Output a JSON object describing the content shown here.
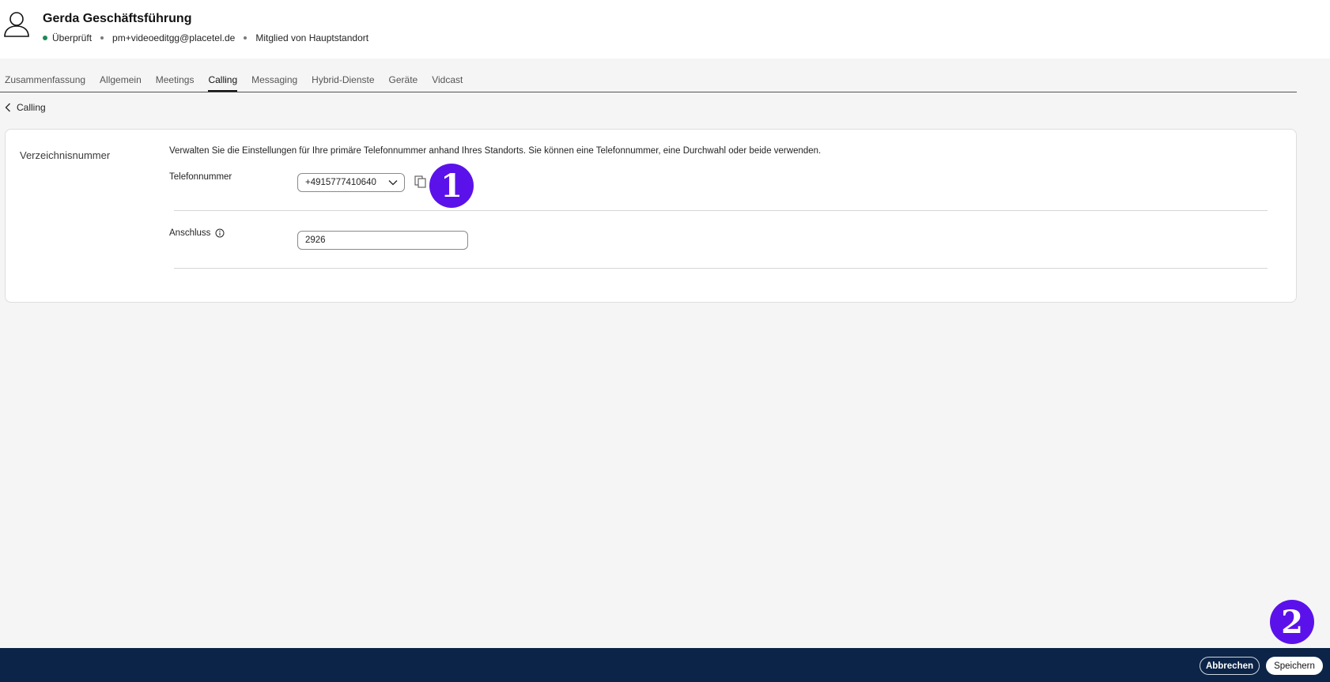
{
  "user": {
    "name": "Gerda Geschäftsführung",
    "status": "Überprüft",
    "email": "pm+videoeditgg@placetel.de",
    "membership": "Mitglied von Hauptstandort"
  },
  "tabs": [
    {
      "label": "Zusammenfassung",
      "active": false
    },
    {
      "label": "Allgemein",
      "active": false
    },
    {
      "label": "Meetings",
      "active": false
    },
    {
      "label": "Calling",
      "active": true
    },
    {
      "label": "Messaging",
      "active": false
    },
    {
      "label": "Hybrid-Dienste",
      "active": false
    },
    {
      "label": "Geräte",
      "active": false
    },
    {
      "label": "Vidcast",
      "active": false
    }
  ],
  "back": {
    "label": "Calling"
  },
  "directory": {
    "section_label": "Verzeichnisnummer",
    "description": "Verwalten Sie die Einstellungen für Ihre primäre Telefonnummer anhand Ihres Standorts. Sie können eine Telefonnummer, eine Durchwahl oder beide verwenden.",
    "phone_label": "Telefonnummer",
    "phone_value": "+4915777410640",
    "extension_label": "Anschluss",
    "extension_value": "2926"
  },
  "markers": [
    "1",
    "2"
  ],
  "footer": {
    "cancel_label": "Abbrechen",
    "save_label": "Speichern"
  },
  "colors": {
    "accent_marker": "#5b12ea",
    "footer_bg": "#0c2447",
    "status_verified": "#1b8a5a"
  },
  "icons": [
    "user-avatar-icon",
    "chevron-left-icon",
    "chevron-down-icon",
    "copy-icon",
    "info-icon"
  ]
}
